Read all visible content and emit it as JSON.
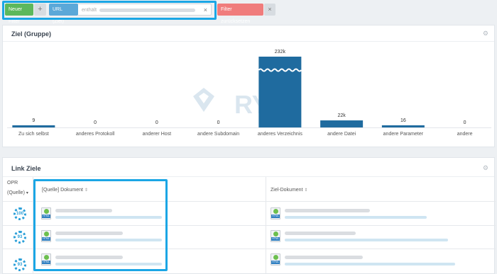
{
  "filters": {
    "new_filter_label": "Neuer Filter",
    "add_symbol": "+",
    "url_filter_label": "URL (Ziel)",
    "operator_text": "enthält",
    "remove_symbol": "×",
    "reset_label": "Filter zurücksetzen",
    "reset_remove_symbol": "×"
  },
  "chart_panel": {
    "title": "Ziel (Gruppe)",
    "settings_icon": "gear-icon",
    "watermark": "RYTE"
  },
  "chart_data": {
    "type": "bar",
    "categories": [
      "Zu sich selbst",
      "anderes Protokoll",
      "anderer Host",
      "andere Subdomain",
      "anderes Verzeichnis",
      "andere Datei",
      "andere Parameter",
      "andere"
    ],
    "values": [
      9,
      0,
      0,
      0,
      232000,
      22000,
      16,
      0
    ],
    "data_labels": [
      "9",
      "0",
      "0",
      "0",
      "232k",
      "22k",
      "16",
      "0"
    ],
    "axis_break": true,
    "bar_color": "#1f6b9f"
  },
  "table_panel": {
    "title": "Link Ziele",
    "settings_icon": "gear-icon",
    "columns": {
      "opr_line1": "OPR",
      "opr_line2": "(Quelle)",
      "source": "[Quelle] Dokument",
      "target": "Ziel-Dokument"
    },
    "sort_icon": "sort-icon",
    "doc_icon_label": "HTML",
    "rows": [
      {
        "opr": "100"
      },
      {
        "opr": "93"
      },
      {
        "opr": "93"
      }
    ]
  }
}
